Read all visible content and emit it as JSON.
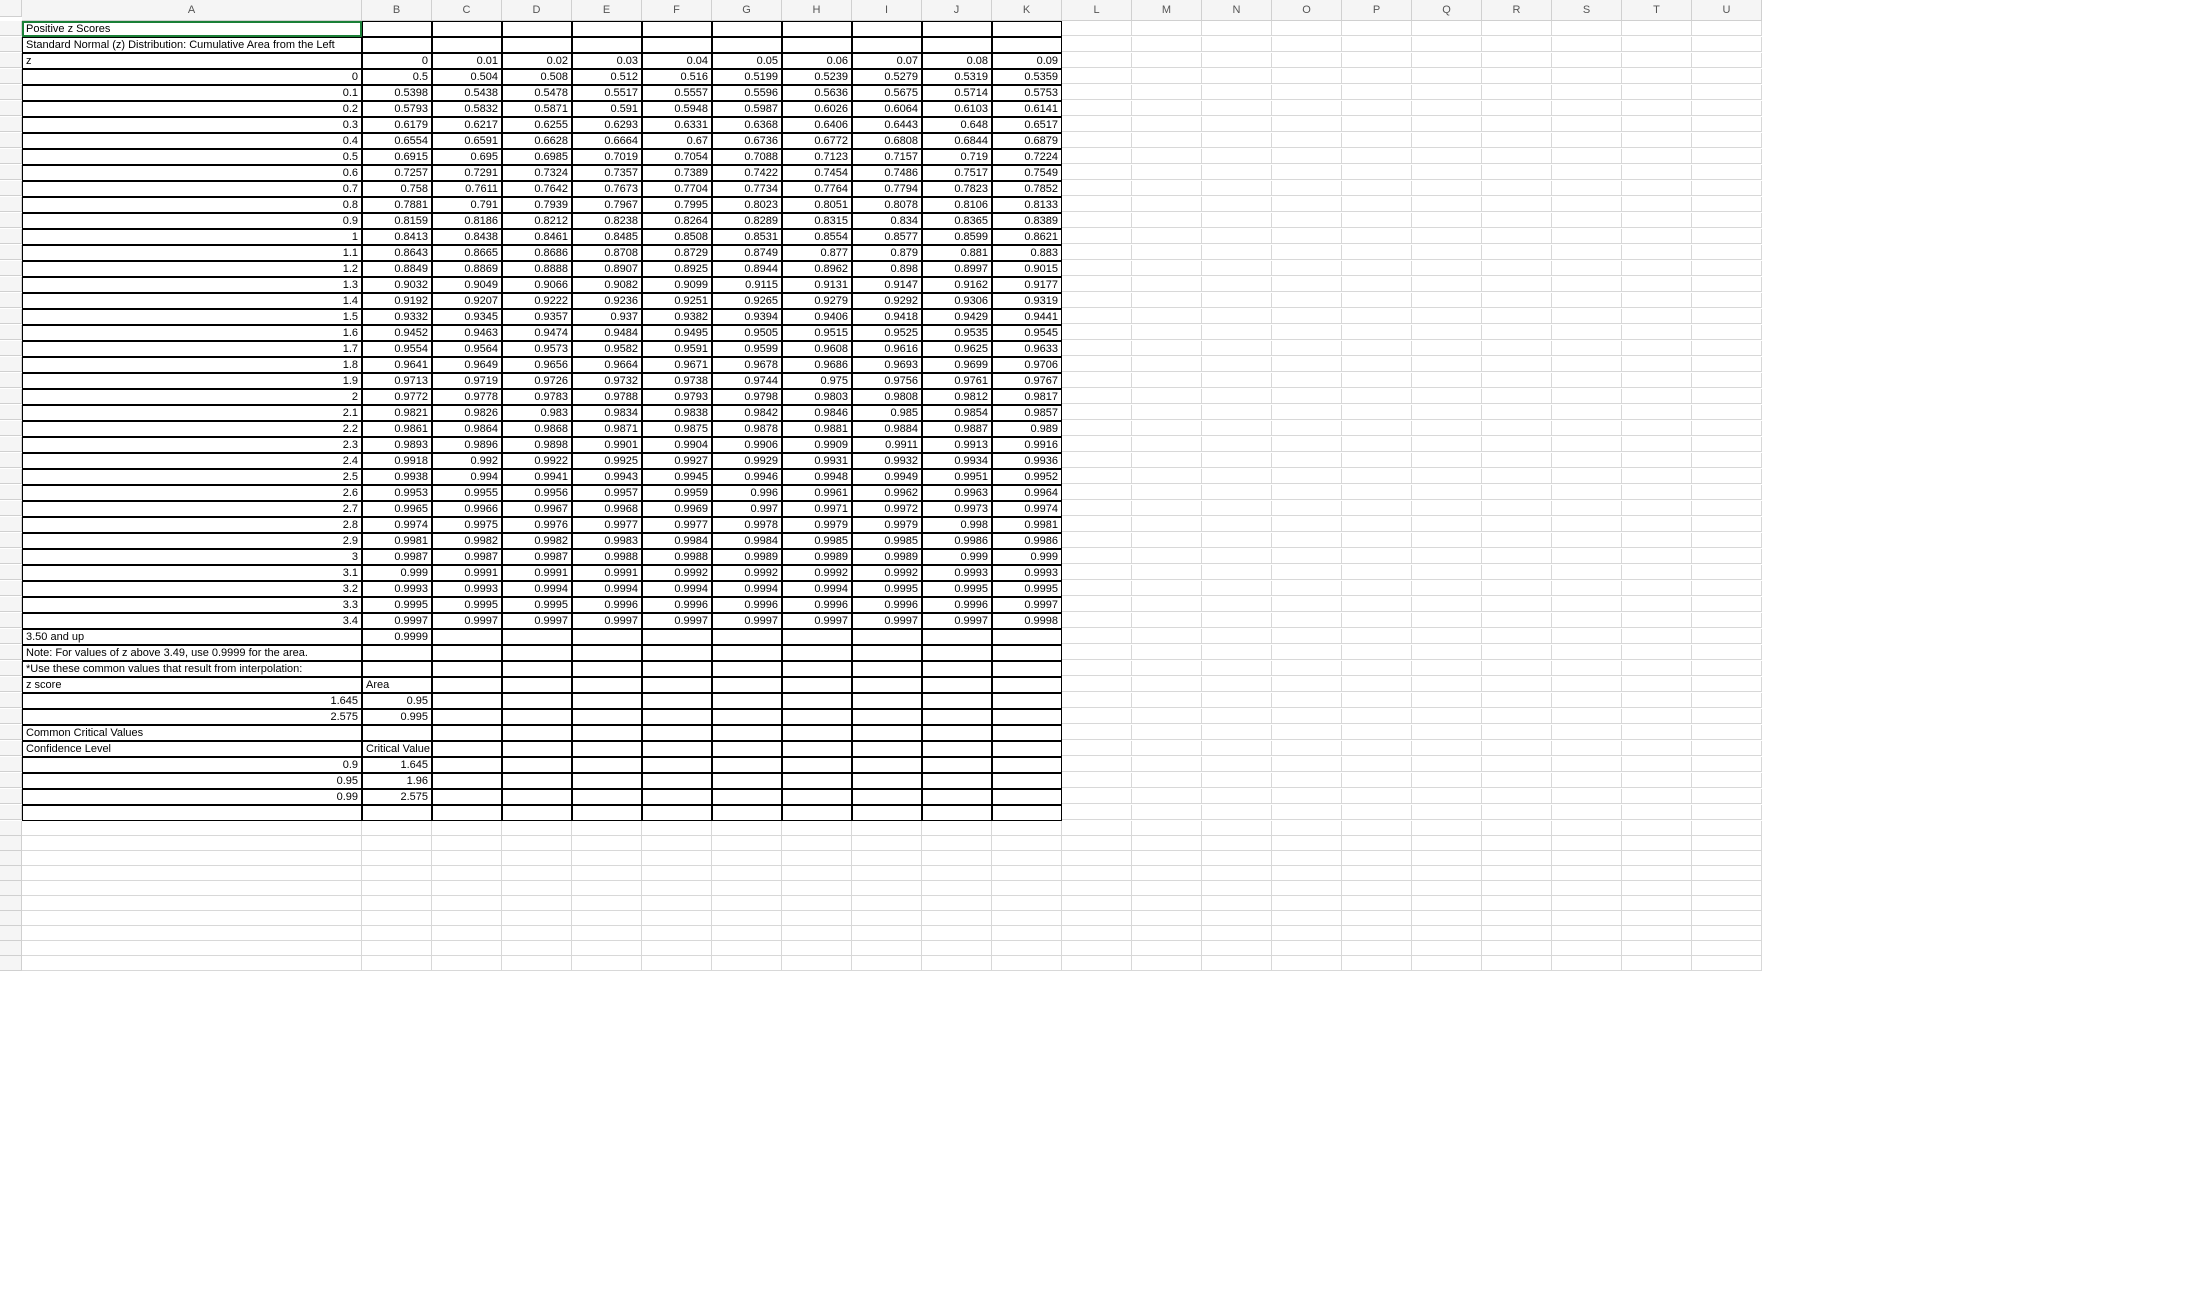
{
  "columns": [
    "A",
    "B",
    "C",
    "D",
    "E",
    "F",
    "G",
    "H",
    "I",
    "J",
    "K",
    "L",
    "M",
    "N",
    "O",
    "P",
    "Q",
    "R",
    "S",
    "T",
    "U"
  ],
  "row_count": 60,
  "selected": {
    "row": 0,
    "col": 0
  },
  "boxed_row_range": [
    0,
    49
  ],
  "boxed_col_range": [
    0,
    10
  ],
  "rows": [
    {
      "A": "Positive z Scores"
    },
    {
      "A": "Standard Normal (z) Distribution: Cumulative Area from the Left"
    },
    {
      "A": "z",
      "B": "0",
      "C": "0.01",
      "D": "0.02",
      "E": "0.03",
      "F": "0.04",
      "G": "0.05",
      "H": "0.06",
      "I": "0.07",
      "J": "0.08",
      "K": "0.09"
    },
    {
      "A": "0",
      "B": "0.5",
      "C": "0.504",
      "D": "0.508",
      "E": "0.512",
      "F": "0.516",
      "G": "0.5199",
      "H": "0.5239",
      "I": "0.5279",
      "J": "0.5319",
      "K": "0.5359"
    },
    {
      "A": "0.1",
      "B": "0.5398",
      "C": "0.5438",
      "D": "0.5478",
      "E": "0.5517",
      "F": "0.5557",
      "G": "0.5596",
      "H": "0.5636",
      "I": "0.5675",
      "J": "0.5714",
      "K": "0.5753"
    },
    {
      "A": "0.2",
      "B": "0.5793",
      "C": "0.5832",
      "D": "0.5871",
      "E": "0.591",
      "F": "0.5948",
      "G": "0.5987",
      "H": "0.6026",
      "I": "0.6064",
      "J": "0.6103",
      "K": "0.6141"
    },
    {
      "A": "0.3",
      "B": "0.6179",
      "C": "0.6217",
      "D": "0.6255",
      "E": "0.6293",
      "F": "0.6331",
      "G": "0.6368",
      "H": "0.6406",
      "I": "0.6443",
      "J": "0.648",
      "K": "0.6517"
    },
    {
      "A": "0.4",
      "B": "0.6554",
      "C": "0.6591",
      "D": "0.6628",
      "E": "0.6664",
      "F": "0.67",
      "G": "0.6736",
      "H": "0.6772",
      "I": "0.6808",
      "J": "0.6844",
      "K": "0.6879"
    },
    {
      "A": "0.5",
      "B": "0.6915",
      "C": "0.695",
      "D": "0.6985",
      "E": "0.7019",
      "F": "0.7054",
      "G": "0.7088",
      "H": "0.7123",
      "I": "0.7157",
      "J": "0.719",
      "K": "0.7224"
    },
    {
      "A": "0.6",
      "B": "0.7257",
      "C": "0.7291",
      "D": "0.7324",
      "E": "0.7357",
      "F": "0.7389",
      "G": "0.7422",
      "H": "0.7454",
      "I": "0.7486",
      "J": "0.7517",
      "K": "0.7549"
    },
    {
      "A": "0.7",
      "B": "0.758",
      "C": "0.7611",
      "D": "0.7642",
      "E": "0.7673",
      "F": "0.7704",
      "G": "0.7734",
      "H": "0.7764",
      "I": "0.7794",
      "J": "0.7823",
      "K": "0.7852"
    },
    {
      "A": "0.8",
      "B": "0.7881",
      "C": "0.791",
      "D": "0.7939",
      "E": "0.7967",
      "F": "0.7995",
      "G": "0.8023",
      "H": "0.8051",
      "I": "0.8078",
      "J": "0.8106",
      "K": "0.8133"
    },
    {
      "A": "0.9",
      "B": "0.8159",
      "C": "0.8186",
      "D": "0.8212",
      "E": "0.8238",
      "F": "0.8264",
      "G": "0.8289",
      "H": "0.8315",
      "I": "0.834",
      "J": "0.8365",
      "K": "0.8389"
    },
    {
      "A": "1",
      "B": "0.8413",
      "C": "0.8438",
      "D": "0.8461",
      "E": "0.8485",
      "F": "0.8508",
      "G": "0.8531",
      "H": "0.8554",
      "I": "0.8577",
      "J": "0.8599",
      "K": "0.8621"
    },
    {
      "A": "1.1",
      "B": "0.8643",
      "C": "0.8665",
      "D": "0.8686",
      "E": "0.8708",
      "F": "0.8729",
      "G": "0.8749",
      "H": "0.877",
      "I": "0.879",
      "J": "0.881",
      "K": "0.883"
    },
    {
      "A": "1.2",
      "B": "0.8849",
      "C": "0.8869",
      "D": "0.8888",
      "E": "0.8907",
      "F": "0.8925",
      "G": "0.8944",
      "H": "0.8962",
      "I": "0.898",
      "J": "0.8997",
      "K": "0.9015"
    },
    {
      "A": "1.3",
      "B": "0.9032",
      "C": "0.9049",
      "D": "0.9066",
      "E": "0.9082",
      "F": "0.9099",
      "G": "0.9115",
      "H": "0.9131",
      "I": "0.9147",
      "J": "0.9162",
      "K": "0.9177"
    },
    {
      "A": "1.4",
      "B": "0.9192",
      "C": "0.9207",
      "D": "0.9222",
      "E": "0.9236",
      "F": "0.9251",
      "G": "0.9265",
      "H": "0.9279",
      "I": "0.9292",
      "J": "0.9306",
      "K": "0.9319"
    },
    {
      "A": "1.5",
      "B": "0.9332",
      "C": "0.9345",
      "D": "0.9357",
      "E": "0.937",
      "F": "0.9382",
      "G": "0.9394",
      "H": "0.9406",
      "I": "0.9418",
      "J": "0.9429",
      "K": "0.9441"
    },
    {
      "A": "1.6",
      "B": "0.9452",
      "C": "0.9463",
      "D": "0.9474",
      "E": "0.9484",
      "F": "0.9495",
      "G": "0.9505",
      "H": "0.9515",
      "I": "0.9525",
      "J": "0.9535",
      "K": "0.9545"
    },
    {
      "A": "1.7",
      "B": "0.9554",
      "C": "0.9564",
      "D": "0.9573",
      "E": "0.9582",
      "F": "0.9591",
      "G": "0.9599",
      "H": "0.9608",
      "I": "0.9616",
      "J": "0.9625",
      "K": "0.9633"
    },
    {
      "A": "1.8",
      "B": "0.9641",
      "C": "0.9649",
      "D": "0.9656",
      "E": "0.9664",
      "F": "0.9671",
      "G": "0.9678",
      "H": "0.9686",
      "I": "0.9693",
      "J": "0.9699",
      "K": "0.9706"
    },
    {
      "A": "1.9",
      "B": "0.9713",
      "C": "0.9719",
      "D": "0.9726",
      "E": "0.9732",
      "F": "0.9738",
      "G": "0.9744",
      "H": "0.975",
      "I": "0.9756",
      "J": "0.9761",
      "K": "0.9767"
    },
    {
      "A": "2",
      "B": "0.9772",
      "C": "0.9778",
      "D": "0.9783",
      "E": "0.9788",
      "F": "0.9793",
      "G": "0.9798",
      "H": "0.9803",
      "I": "0.9808",
      "J": "0.9812",
      "K": "0.9817"
    },
    {
      "A": "2.1",
      "B": "0.9821",
      "C": "0.9826",
      "D": "0.983",
      "E": "0.9834",
      "F": "0.9838",
      "G": "0.9842",
      "H": "0.9846",
      "I": "0.985",
      "J": "0.9854",
      "K": "0.9857"
    },
    {
      "A": "2.2",
      "B": "0.9861",
      "C": "0.9864",
      "D": "0.9868",
      "E": "0.9871",
      "F": "0.9875",
      "G": "0.9878",
      "H": "0.9881",
      "I": "0.9884",
      "J": "0.9887",
      "K": "0.989"
    },
    {
      "A": "2.3",
      "B": "0.9893",
      "C": "0.9896",
      "D": "0.9898",
      "E": "0.9901",
      "F": "0.9904",
      "G": "0.9906",
      "H": "0.9909",
      "I": "0.9911",
      "J": "0.9913",
      "K": "0.9916"
    },
    {
      "A": "2.4",
      "B": "0.9918",
      "C": "0.992",
      "D": "0.9922",
      "E": "0.9925",
      "F": "0.9927",
      "G": "0.9929",
      "H": "0.9931",
      "I": "0.9932",
      "J": "0.9934",
      "K": "0.9936"
    },
    {
      "A": "2.5",
      "B": "0.9938",
      "C": "0.994",
      "D": "0.9941",
      "E": "0.9943",
      "F": "0.9945",
      "G": "0.9946",
      "H": "0.9948",
      "I": "0.9949",
      "J": "0.9951",
      "K": "0.9952"
    },
    {
      "A": "2.6",
      "B": "0.9953",
      "C": "0.9955",
      "D": "0.9956",
      "E": "0.9957",
      "F": "0.9959",
      "G": "0.996",
      "H": "0.9961",
      "I": "0.9962",
      "J": "0.9963",
      "K": "0.9964"
    },
    {
      "A": "2.7",
      "B": "0.9965",
      "C": "0.9966",
      "D": "0.9967",
      "E": "0.9968",
      "F": "0.9969",
      "G": "0.997",
      "H": "0.9971",
      "I": "0.9972",
      "J": "0.9973",
      "K": "0.9974"
    },
    {
      "A": "2.8",
      "B": "0.9974",
      "C": "0.9975",
      "D": "0.9976",
      "E": "0.9977",
      "F": "0.9977",
      "G": "0.9978",
      "H": "0.9979",
      "I": "0.9979",
      "J": "0.998",
      "K": "0.9981"
    },
    {
      "A": "2.9",
      "B": "0.9981",
      "C": "0.9982",
      "D": "0.9982",
      "E": "0.9983",
      "F": "0.9984",
      "G": "0.9984",
      "H": "0.9985",
      "I": "0.9985",
      "J": "0.9986",
      "K": "0.9986"
    },
    {
      "A": "3",
      "B": "0.9987",
      "C": "0.9987",
      "D": "0.9987",
      "E": "0.9988",
      "F": "0.9988",
      "G": "0.9989",
      "H": "0.9989",
      "I": "0.9989",
      "J": "0.999",
      "K": "0.999"
    },
    {
      "A": "3.1",
      "B": "0.999",
      "C": "0.9991",
      "D": "0.9991",
      "E": "0.9991",
      "F": "0.9992",
      "G": "0.9992",
      "H": "0.9992",
      "I": "0.9992",
      "J": "0.9993",
      "K": "0.9993"
    },
    {
      "A": "3.2",
      "B": "0.9993",
      "C": "0.9993",
      "D": "0.9994",
      "E": "0.9994",
      "F": "0.9994",
      "G": "0.9994",
      "H": "0.9994",
      "I": "0.9995",
      "J": "0.9995",
      "K": "0.9995"
    },
    {
      "A": "3.3",
      "B": "0.9995",
      "C": "0.9995",
      "D": "0.9995",
      "E": "0.9996",
      "F": "0.9996",
      "G": "0.9996",
      "H": "0.9996",
      "I": "0.9996",
      "J": "0.9996",
      "K": "0.9997"
    },
    {
      "A": "3.4",
      "B": "0.9997",
      "C": "0.9997",
      "D": "0.9997",
      "E": "0.9997",
      "F": "0.9997",
      "G": "0.9997",
      "H": "0.9997",
      "I": "0.9997",
      "J": "0.9997",
      "K": "0.9998"
    },
    {
      "A": "3.50 and up",
      "B": "0.9999"
    },
    {
      "A": "Note: For values of z above 3.49, use 0.9999 for the area."
    },
    {
      "A": "*Use these common values that result from interpolation:"
    },
    {
      "A": "z score",
      "B": "Area"
    },
    {
      "A": "1.645",
      "B": "0.95"
    },
    {
      "A": "2.575",
      "B": "0.995"
    },
    {
      "A": "Common Critical Values"
    },
    {
      "A": "Confidence Level",
      "B": "Critical Value"
    },
    {
      "A": "0.9",
      "B": "1.645"
    },
    {
      "A": "0.95",
      "B": "1.96"
    },
    {
      "A": "0.99",
      "B": "2.575"
    },
    {}
  ],
  "left_align_A": [
    0,
    1,
    2,
    38,
    39,
    40,
    41,
    44,
    45
  ],
  "left_align_B": [
    41,
    45
  ]
}
